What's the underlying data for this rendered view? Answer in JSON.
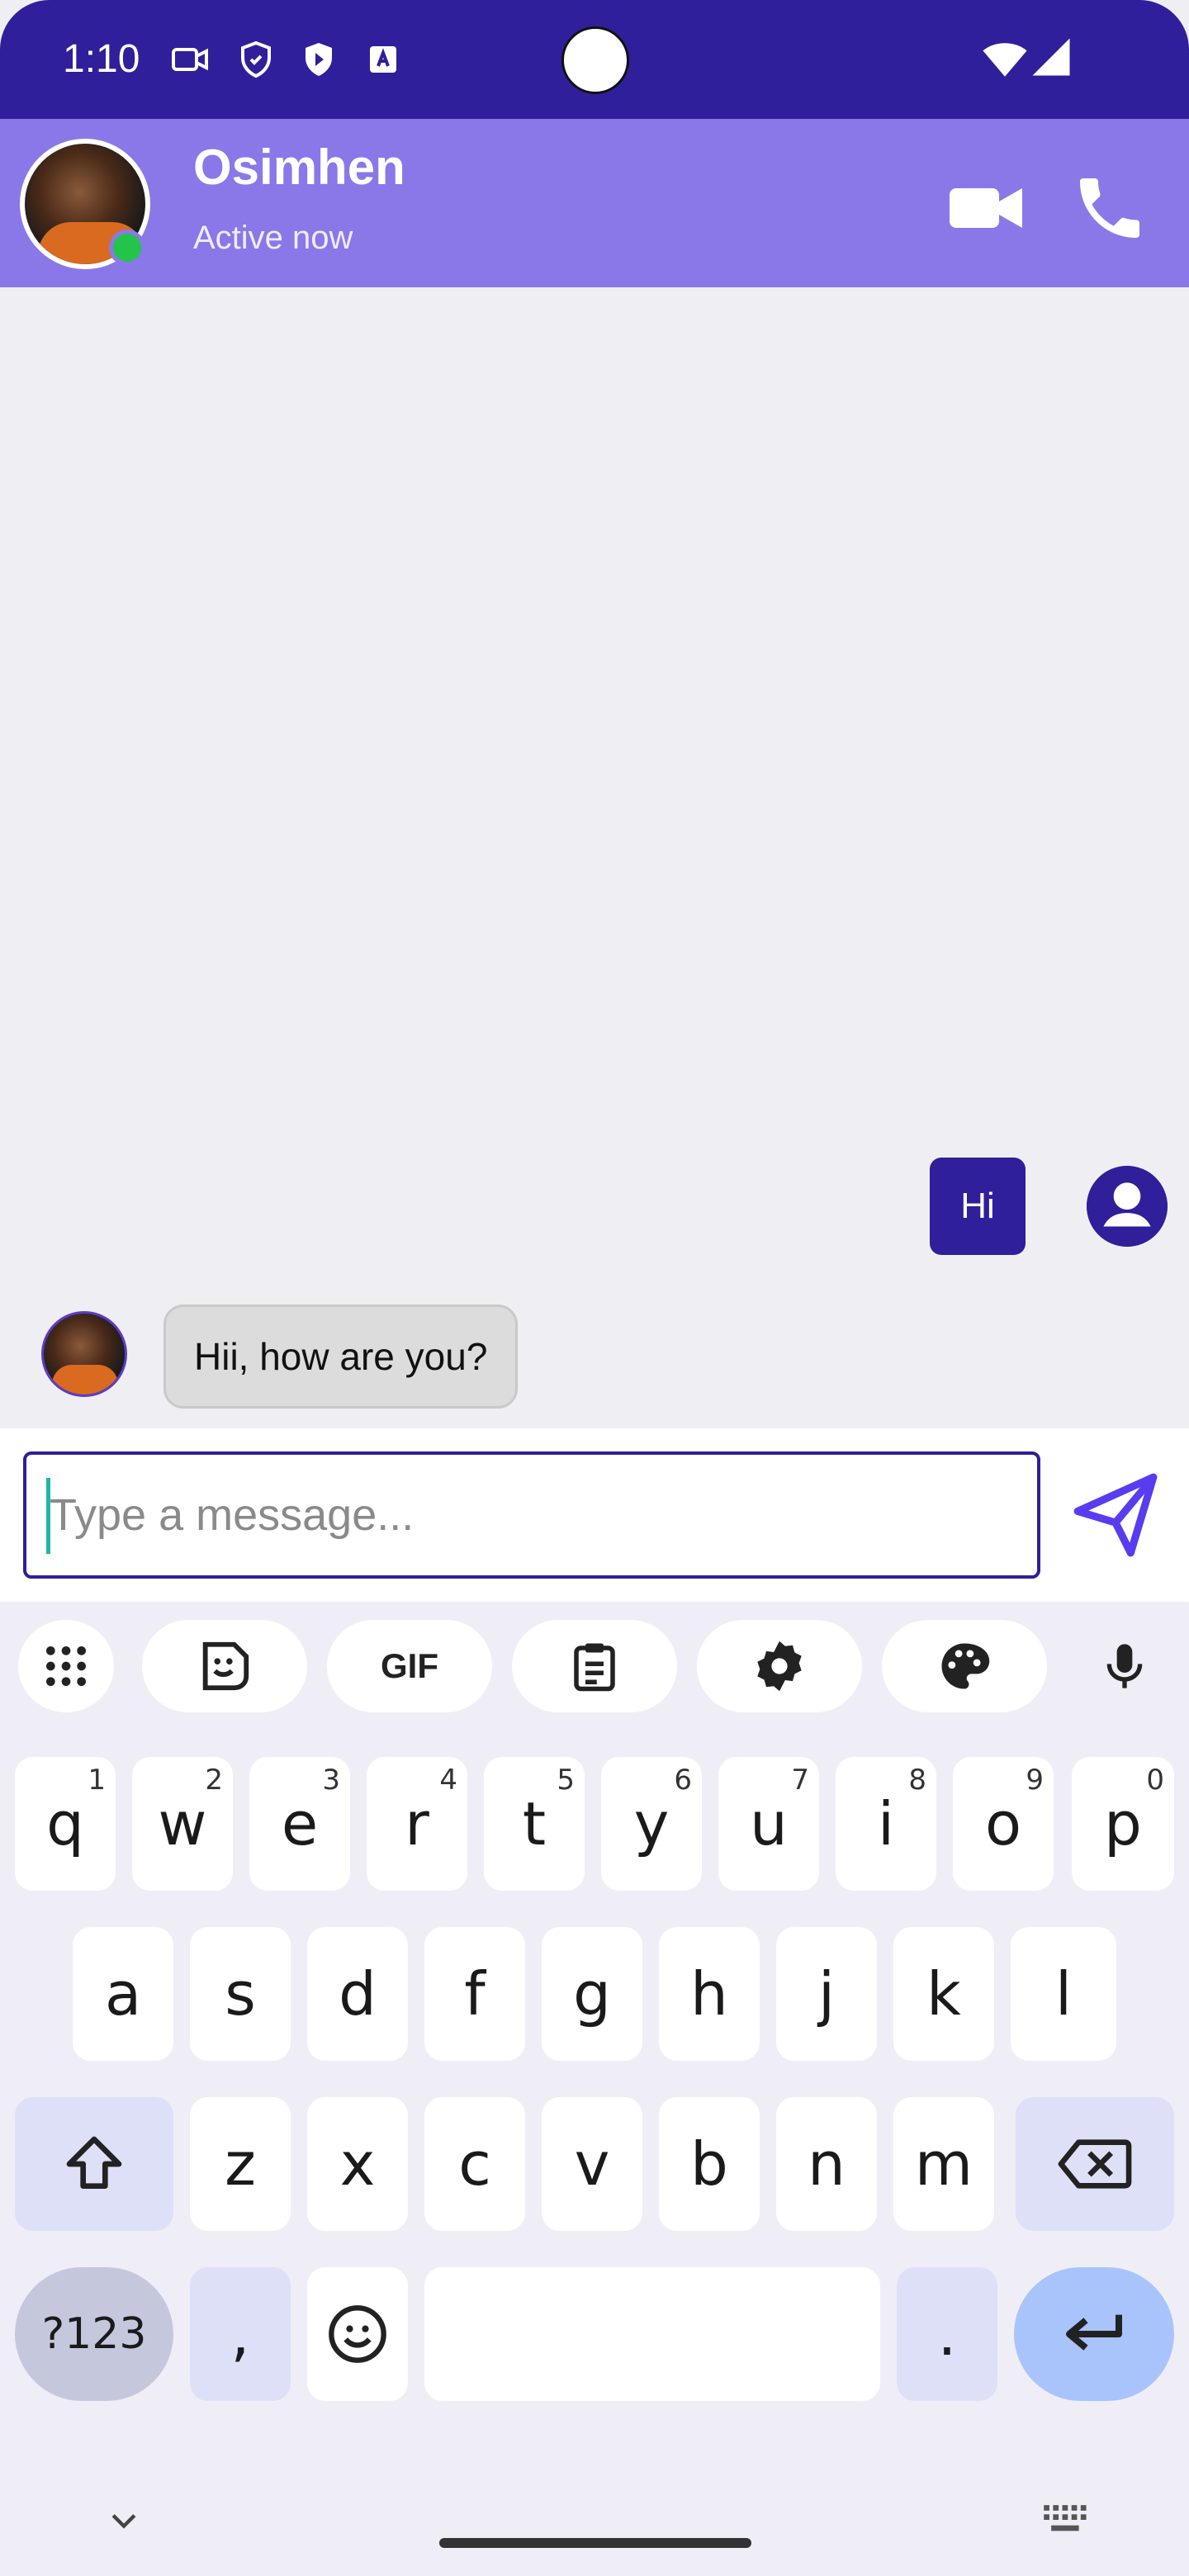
{
  "status_bar": {
    "time": "1:10",
    "bg": "#2f1f9a"
  },
  "header": {
    "name": "Osimhen",
    "status": "Active now",
    "bg": "#8a78e8",
    "online_color": "#22c44a"
  },
  "messages": [
    {
      "direction": "out",
      "text": "Hi"
    },
    {
      "direction": "in",
      "text": "Hii, how are you?"
    }
  ],
  "composer": {
    "placeholder": "Type a message...",
    "value": "",
    "accent": "#2f1f9a"
  },
  "keyboard": {
    "toolbar": [
      {
        "name": "apps-grid-icon"
      },
      {
        "name": "sticker-icon"
      },
      {
        "name": "gif-button",
        "label": "GIF"
      },
      {
        "name": "clipboard-icon"
      },
      {
        "name": "settings-icon"
      },
      {
        "name": "palette-icon"
      },
      {
        "name": "mic-icon"
      }
    ],
    "row1": [
      {
        "k": "q",
        "n": "1"
      },
      {
        "k": "w",
        "n": "2"
      },
      {
        "k": "e",
        "n": "3"
      },
      {
        "k": "r",
        "n": "4"
      },
      {
        "k": "t",
        "n": "5"
      },
      {
        "k": "y",
        "n": "6"
      },
      {
        "k": "u",
        "n": "7"
      },
      {
        "k": "i",
        "n": "8"
      },
      {
        "k": "o",
        "n": "9"
      },
      {
        "k": "p",
        "n": "0"
      }
    ],
    "row2": [
      "a",
      "s",
      "d",
      "f",
      "g",
      "h",
      "j",
      "k",
      "l"
    ],
    "row3": [
      "z",
      "x",
      "c",
      "v",
      "b",
      "n",
      "m"
    ],
    "sym_label": "?123",
    "comma": ",",
    "period": "."
  }
}
